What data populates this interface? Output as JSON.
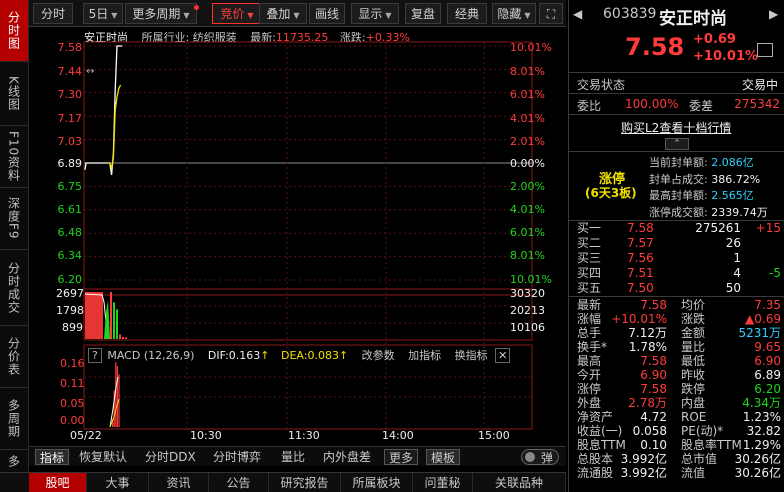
{
  "left_tabs": [
    "分时图",
    "K线图",
    "F10资料",
    "深度F9",
    "分时成交",
    "分价表",
    "多周期",
    "多"
  ],
  "toolbar": {
    "fenshi": "分时",
    "days": "5日",
    "more_period": "更多周期",
    "bidding": "竞价",
    "overlay": "叠加",
    "draw_line": "画线",
    "display": "显示",
    "replay": "复盘",
    "classic": "经典",
    "hide": "隐藏"
  },
  "info": {
    "name": "安正时尚",
    "industry": "所属行业: 纺织服装",
    "latest_label": "最新:",
    "latest": "11735.25",
    "change_label": "涨跌:",
    "change": "+0.33%"
  },
  "price_axis": {
    "left": [
      "7.58",
      "7.44",
      "7.30",
      "7.17",
      "7.03",
      "6.89",
      "6.75",
      "6.61",
      "6.48",
      "6.34",
      "6.20"
    ],
    "right": [
      "10.01%",
      "8.01%",
      "6.01%",
      "4.01%",
      "2.01%",
      "0.00%",
      "2.00%",
      "4.01%",
      "6.01%",
      "8.01%",
      "10.01%"
    ]
  },
  "volume_axis": {
    "left": [
      "2697",
      "1798",
      "899"
    ],
    "right": [
      "30320",
      "20213",
      "10106"
    ]
  },
  "macd": {
    "help": "?",
    "label": "MACD (12,26,9)",
    "dif": "DIF:0.163",
    "dea": "DEA:0.083",
    "change_params": "改参数",
    "add_indicator": "加指标",
    "switch_indicator": "换指标",
    "axis": [
      "0.16",
      "0.11",
      "0.05",
      "0.00"
    ]
  },
  "time_axis": [
    "05/22",
    "10:30",
    "11:30",
    "14:00",
    "15:00"
  ],
  "chart_data": {
    "type": "line",
    "title": "安正时尚",
    "pre_close": 6.89,
    "ylim": [
      6.2,
      7.58
    ],
    "x": [
      "09:30",
      "09:31",
      "09:32",
      "09:33",
      "09:34",
      "09:35",
      "09:36",
      "09:37"
    ],
    "series": [
      {
        "values": [
          6.89,
          6.89,
          6.82,
          6.95,
          7.32,
          7.58,
          7.58,
          7.58
        ]
      },
      {
        "values": [
          6.89,
          6.89,
          6.86,
          6.92,
          7.2,
          7.28,
          7.33,
          7.35
        ]
      }
    ],
    "pre_open_line": [
      6.85,
      6.89
    ],
    "volume": {
      "ylim": [
        0,
        2697
      ],
      "values": [
        120,
        150,
        2697,
        2100,
        1700,
        260,
        120,
        90
      ]
    },
    "macd": {
      "ylim": [
        0,
        0.16
      ],
      "values": [
        0.02,
        0.09,
        0.16,
        0.15,
        0.13
      ]
    }
  },
  "bottom_bar": {
    "indicator": "指标",
    "restore": "恢复默认",
    "ddx": "分时DDX",
    "game": "分时博弈",
    "volume_ratio": "量比",
    "in_out": "内外盘差",
    "more": "更多",
    "template": "模板",
    "popup": "弹"
  },
  "bottom_tabs": [
    "股吧",
    "大事",
    "资讯",
    "公告",
    "研究报告",
    "所属板块",
    "问董秘",
    "关联品种"
  ],
  "right": {
    "code": "603839",
    "name": "安正时尚",
    "price": "7.58",
    "change": "+0.69",
    "change_pct": "+10.01%",
    "trade_status_label": "交易状态",
    "trade_status": "交易中",
    "weibi_label": "委比",
    "weibi": "100.00%",
    "weicha_label": "委差",
    "weicha": "275342",
    "l2_link": "购买L2查看十档行情",
    "limit_up": "涨停",
    "limit_days": "(6天3板)",
    "limit_info": [
      {
        "label": "当前封单额:",
        "value": "2.086亿"
      },
      {
        "label": "封单占成交:",
        "value": "386.72%"
      },
      {
        "label": "最高封单额:",
        "value": "2.565亿"
      },
      {
        "label": "涨停成交额:",
        "value": "2339.74万"
      }
    ],
    "bids": [
      {
        "label": "买一",
        "price": "7.58",
        "vol": "275261",
        "diff": "+15"
      },
      {
        "label": "买二",
        "price": "7.57",
        "vol": "26",
        "diff": ""
      },
      {
        "label": "买三",
        "price": "7.56",
        "vol": "1",
        "diff": ""
      },
      {
        "label": "买四",
        "price": "7.51",
        "vol": "4",
        "diff": "-5"
      },
      {
        "label": "买五",
        "price": "7.50",
        "vol": "50",
        "diff": ""
      }
    ],
    "stats": [
      {
        "l1": "最新",
        "v1": "7.58",
        "c1": "red",
        "l2": "均价",
        "v2": "7.35",
        "c2": "red"
      },
      {
        "l1": "涨幅",
        "v1": "+10.01%",
        "c1": "red",
        "l2": "涨跌",
        "v2": "▲0.69",
        "c2": "red"
      },
      {
        "l1": "总手",
        "v1": "7.12万",
        "c1": "white",
        "l2": "金额",
        "v2": "5231万",
        "c2": "cyan"
      },
      {
        "l1": "换手*",
        "v1": "1.78%",
        "c1": "white",
        "l2": "量比",
        "v2": "9.65",
        "c2": "red"
      },
      {
        "l1": "最高",
        "v1": "7.58",
        "c1": "red",
        "l2": "最低",
        "v2": "6.90",
        "c2": "red"
      },
      {
        "l1": "今开",
        "v1": "6.90",
        "c1": "red",
        "l2": "昨收",
        "v2": "6.89",
        "c2": "white"
      },
      {
        "l1": "涨停",
        "v1": "7.58",
        "c1": "red",
        "l2": "跌停",
        "v2": "6.20",
        "c2": "green"
      },
      {
        "l1": "外盘",
        "v1": "2.78万",
        "c1": "red",
        "l2": "内盘",
        "v2": "4.34万",
        "c2": "green"
      },
      {
        "l1": "净资产",
        "v1": "4.72",
        "c1": "white",
        "l2": "ROE",
        "v2": "1.23%",
        "c2": "white"
      },
      {
        "l1": "收益(一)",
        "v1": "0.058",
        "c1": "white",
        "l2": "PE(动)*",
        "v2": "32.82",
        "c2": "white"
      },
      {
        "l1": "股息TTM",
        "v1": "0.10",
        "c1": "white",
        "l2": "股息率TTM",
        "v2": "1.29%",
        "c2": "white"
      },
      {
        "l1": "总股本",
        "v1": "3.992亿",
        "c1": "white",
        "l2": "总市值",
        "v2": "30.26亿",
        "c2": "white"
      },
      {
        "l1": "流通股",
        "v1": "3.992亿",
        "c1": "white",
        "l2": "流值",
        "v2": "30.26亿",
        "c2": "white"
      }
    ]
  },
  "colors": {
    "up": "#ff3b3b",
    "down": "#1ed41e",
    "accent": "#b40000",
    "price_line": "#ffffff",
    "avg_line": "#f0e000"
  }
}
